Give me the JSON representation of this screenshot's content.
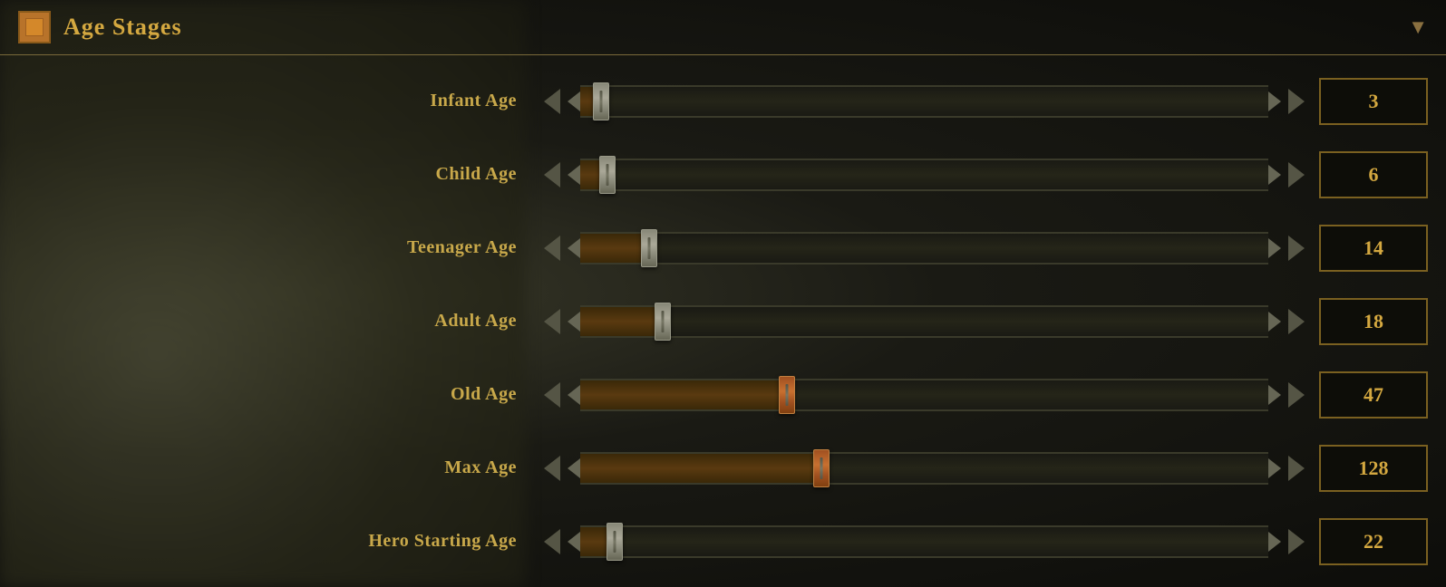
{
  "header": {
    "title": "Age Stages",
    "icon_label": "age-stages-icon",
    "chevron": "▼"
  },
  "rows": [
    {
      "id": "infant-age",
      "label": "Infant Age",
      "value": 3,
      "thumb_pct": 3,
      "thumb_type": "normal",
      "fill_pct": 3
    },
    {
      "id": "child-age",
      "label": "Child Age",
      "value": 6,
      "thumb_pct": 4,
      "thumb_type": "normal",
      "fill_pct": 4
    },
    {
      "id": "teenager-age",
      "label": "Teenager Age",
      "value": 14,
      "thumb_pct": 10,
      "thumb_type": "normal",
      "fill_pct": 10
    },
    {
      "id": "adult-age",
      "label": "Adult Age",
      "value": 18,
      "thumb_pct": 12,
      "thumb_type": "normal",
      "fill_pct": 12
    },
    {
      "id": "old-age",
      "label": "Old Age",
      "value": 47,
      "thumb_pct": 30,
      "thumb_type": "orange",
      "fill_pct": 30
    },
    {
      "id": "max-age",
      "label": "Max Age",
      "value": 128,
      "thumb_pct": 35,
      "thumb_type": "orange",
      "fill_pct": 35
    },
    {
      "id": "hero-starting-age",
      "label": "Hero Starting Age",
      "value": 22,
      "thumb_pct": 5,
      "thumb_type": "normal",
      "fill_pct": 5
    }
  ]
}
